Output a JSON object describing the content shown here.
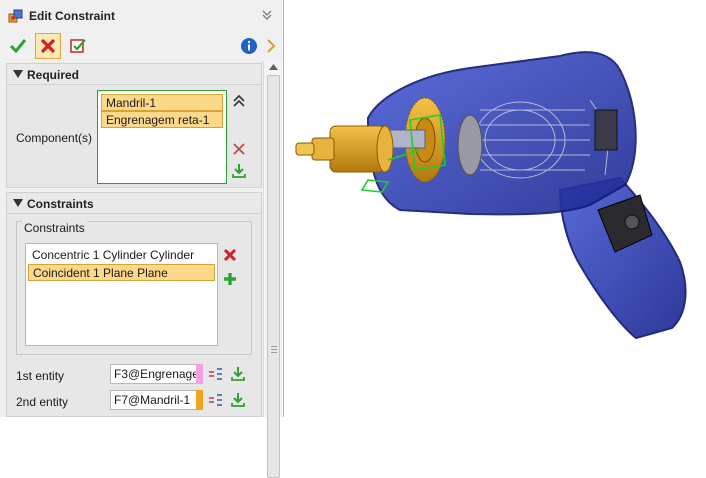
{
  "window": {
    "title": "Edit Constraint"
  },
  "toolbar": {
    "ok_icon": "check-icon",
    "cancel_icon": "red-x-icon",
    "apply_icon": "apply-icon",
    "info_icon": "info-icon"
  },
  "sections": {
    "required": {
      "title": "Required",
      "component_label": "Component(s)",
      "components": [
        "Mandril-1",
        "Engrenagem reta-1"
      ]
    },
    "constraints": {
      "title": "Constraints",
      "group_title": "Constraints",
      "items": [
        {
          "label": "Concentric 1  Cylinder  Cylinder",
          "selected": false
        },
        {
          "label": "Coincident 1  Plane  Plane",
          "selected": true
        }
      ]
    }
  },
  "entities": [
    {
      "label": "1st entity",
      "value": "F3@Engrenage",
      "color": "#f0a3e0"
    },
    {
      "label": "2nd entity",
      "value": "F7@Mandril-1",
      "color": "#f0a51c"
    }
  ],
  "colors": {
    "accent_green": "#2e9e2e",
    "selection": "#fbd88a",
    "housing_blue": "#2f3fb0",
    "gear_gold": "#d99b1a"
  }
}
